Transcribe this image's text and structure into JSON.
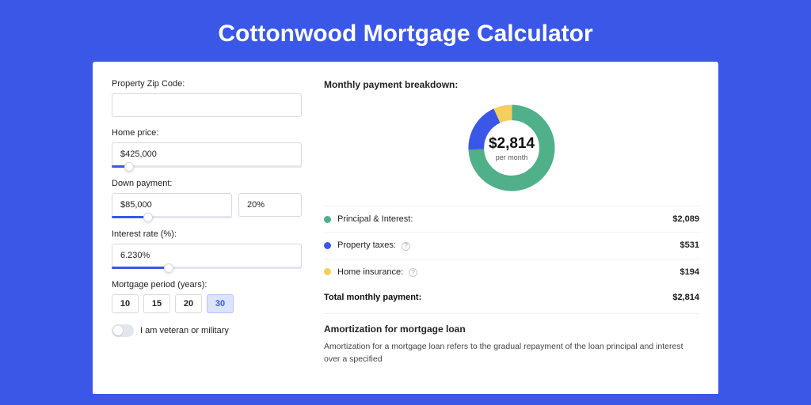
{
  "title": "Cottonwood Mortgage Calculator",
  "form": {
    "zip": {
      "label": "Property Zip Code:",
      "value": ""
    },
    "home_price": {
      "label": "Home price:",
      "value": "$425,000",
      "slider_pct": 9
    },
    "down_payment": {
      "label": "Down payment:",
      "amount": "$85,000",
      "percent": "20%",
      "slider_pct": 20
    },
    "interest": {
      "label": "Interest rate (%):",
      "value": "6.230%",
      "slider_pct": 30
    },
    "period": {
      "label": "Mortgage period (years):",
      "options": [
        "10",
        "15",
        "20",
        "30"
      ],
      "active": "30"
    },
    "veteran": {
      "label": "I am veteran or military"
    }
  },
  "breakdown": {
    "title": "Monthly payment breakdown:",
    "center_amount": "$2,814",
    "center_sub": "per month",
    "items": [
      {
        "label": "Principal & Interest:",
        "amount": "$2,089",
        "color": "green",
        "info": false
      },
      {
        "label": "Property taxes:",
        "amount": "$531",
        "color": "blue",
        "info": true
      },
      {
        "label": "Home insurance:",
        "amount": "$194",
        "color": "yellow",
        "info": true
      }
    ],
    "total_label": "Total monthly payment:",
    "total_amount": "$2,814"
  },
  "amort": {
    "title": "Amortization for mortgage loan",
    "text": "Amortization for a mortgage loan refers to the gradual repayment of the loan principal and interest over a specified"
  },
  "chart_data": {
    "type": "pie",
    "title": "Monthly payment breakdown",
    "series": [
      {
        "name": "Principal & Interest",
        "value": 2089,
        "color": "#4fb08a"
      },
      {
        "name": "Property taxes",
        "value": 531,
        "color": "#3a57e8"
      },
      {
        "name": "Home insurance",
        "value": 194,
        "color": "#f4cf5d"
      }
    ],
    "total": 2814,
    "unit": "USD per month"
  }
}
